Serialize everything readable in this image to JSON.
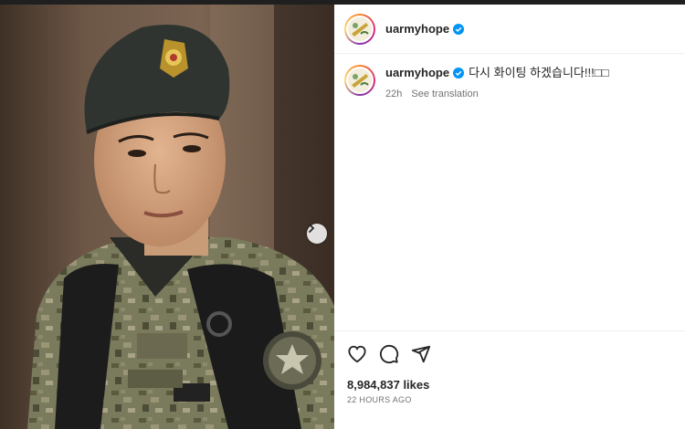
{
  "post": {
    "username": "uarmyhope",
    "caption": "다시 화이팅 하겠습니다!!!",
    "caption_emoji": "□□",
    "relative_time": "22h",
    "see_translation": "See translation",
    "likes": "8,984,837 likes",
    "time_ago": "22 HOURS AGO"
  },
  "colors": {
    "verified": "#0095f6",
    "text": "#262626",
    "muted": "#737373"
  },
  "icons": {
    "next": "chevron-right-icon",
    "like": "heart-icon",
    "comment": "comment-icon",
    "share": "send-icon",
    "verified": "verified-badge-icon"
  }
}
